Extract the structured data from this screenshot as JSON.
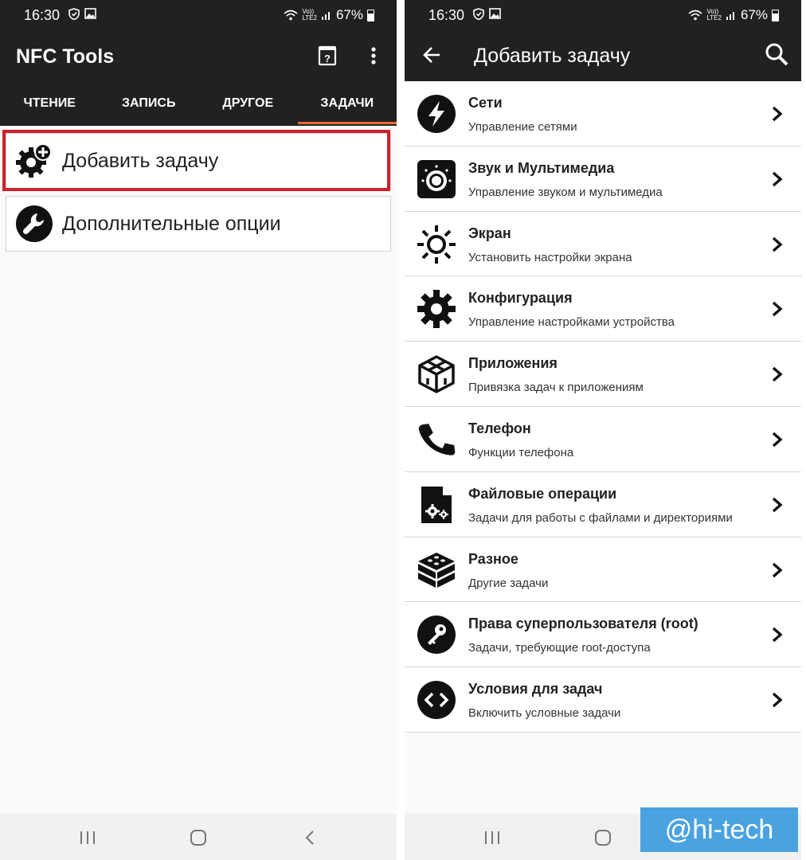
{
  "status_bar": {
    "time": "16:30",
    "battery": "67%",
    "lte_top": "Vo))",
    "lte_bottom": "LTE2"
  },
  "left_screen": {
    "app_title": "NFC Tools",
    "tabs": [
      {
        "label": "ЧТЕНИЕ"
      },
      {
        "label": "ЗАПИСЬ"
      },
      {
        "label": "ДРУГОЕ"
      },
      {
        "label": "ЗАДАЧИ",
        "active": true
      }
    ],
    "items": [
      {
        "label": "Добавить задачу",
        "icon": "gear-plus-icon"
      },
      {
        "label": "Дополнительные опции",
        "icon": "wrench-icon"
      }
    ]
  },
  "right_screen": {
    "title": "Добавить задачу",
    "rows": [
      {
        "title": "Сети",
        "subtitle": "Управление сетями",
        "icon": "lightning-icon"
      },
      {
        "title": "Звук и Мультимедиа",
        "subtitle": "Управление звуком и мультимедиа",
        "icon": "speaker-dial-icon"
      },
      {
        "title": "Экран",
        "subtitle": "Установить настройки экрана",
        "icon": "sun-icon"
      },
      {
        "title": "Конфигурация",
        "subtitle": "Управление настройками устройства",
        "icon": "gear-icon"
      },
      {
        "title": "Приложения",
        "subtitle": "Привязка задач к приложениям",
        "icon": "cube-icon"
      },
      {
        "title": "Телефон",
        "subtitle": "Функции телефона",
        "icon": "phone-icon"
      },
      {
        "title": "Файловые операции",
        "subtitle": "Задачи для работы с файлами и директориями",
        "icon": "file-gear-icon"
      },
      {
        "title": "Разное",
        "subtitle": "Другие задачи",
        "icon": "bricks-icon"
      },
      {
        "title": "Права суперпользователя (root)",
        "subtitle": "Задачи, требующие root-доступа",
        "icon": "key-icon"
      },
      {
        "title": "Условия для задач",
        "subtitle": "Включить условные задачи",
        "icon": "code-brackets-icon"
      }
    ]
  },
  "watermark": {
    "text": "@hi-tech"
  },
  "colors": {
    "bar_dark": "#212121",
    "accent": "#f06a35",
    "highlight": "#d0202a",
    "watermark_bg": "#4aa3e0"
  }
}
